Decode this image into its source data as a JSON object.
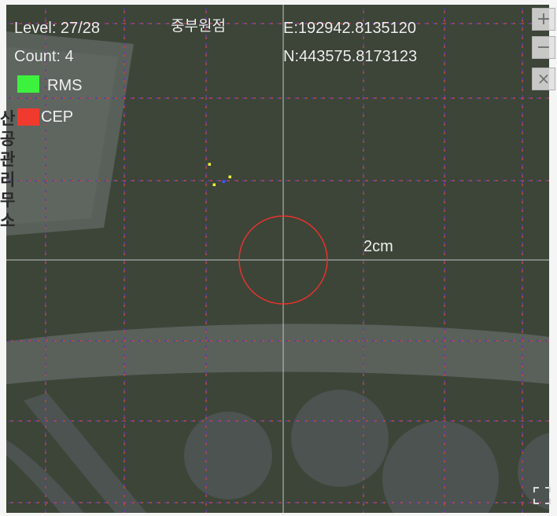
{
  "hud": {
    "level": "Level: 27/28",
    "count": "Count: 4",
    "origin_label": "중부원점",
    "easting": "E:192942.8135120",
    "northing": "N:443575.8173123"
  },
  "legend": {
    "rms": {
      "label": "RMS",
      "color": "#3df23d"
    },
    "cep": {
      "label": "CEP",
      "color": "#f03a2e"
    }
  },
  "basemap": {
    "partial_label": "산공관리무소"
  },
  "scale": {
    "label": "2cm",
    "circle_color": "#e8332b"
  },
  "controls": {
    "zoom_in": "+",
    "zoom_out": "−",
    "close": "×",
    "fullscreen_icon": "fullscreen-icon"
  },
  "colors": {
    "map_background": "#3c4538",
    "grid_line": "#5a3ea8",
    "grid_dash": "#d24a2c",
    "crosshair": "#d8d8d8"
  },
  "points": [
    {
      "color": "#f2f230"
    },
    {
      "color": "#f2f230"
    },
    {
      "color": "#f2f230"
    },
    {
      "color": "#3b5bff"
    }
  ]
}
